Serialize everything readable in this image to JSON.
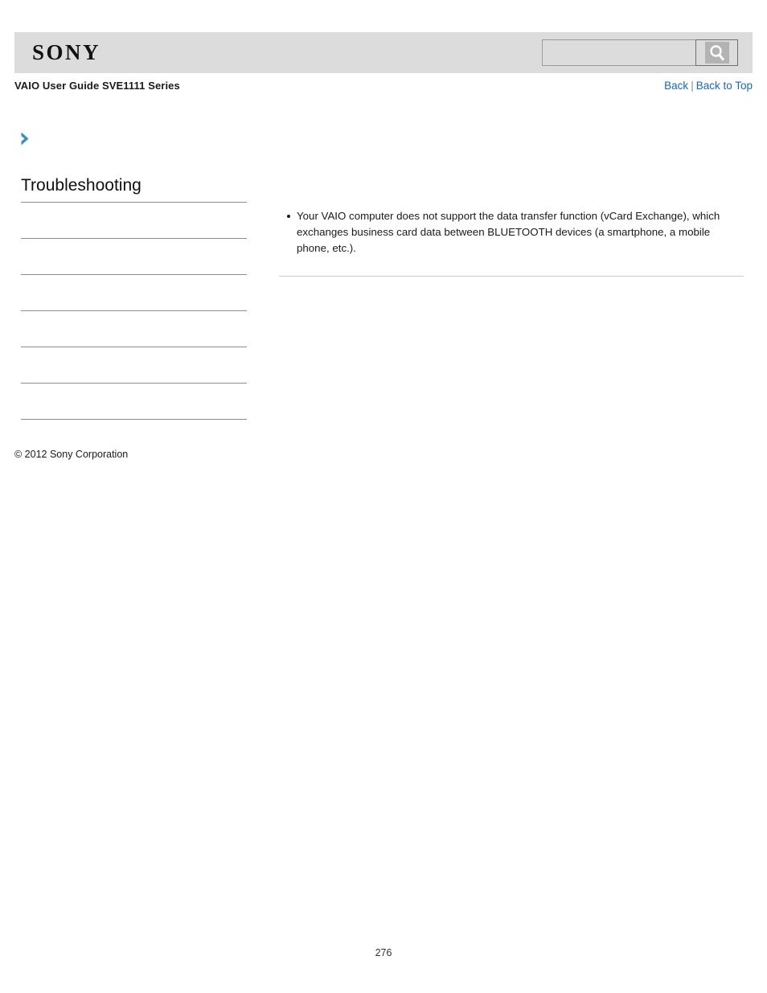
{
  "header": {
    "logo_text": "SONY",
    "logo_icon": "sony-wordmark",
    "background_color": "#dcdcdc"
  },
  "search": {
    "value": "",
    "placeholder": "",
    "button_icon": "search-icon",
    "button_label": "Search"
  },
  "subheader": {
    "guide_title": "VAIO User Guide SVE1111 Series",
    "links": [
      {
        "label": "Back"
      },
      {
        "label": "Back to Top"
      }
    ],
    "separator": "|",
    "link_color": "#1668c4"
  },
  "breadcrumb_icon": {
    "name": "chevron-right-icon",
    "color": "#3a8dc8"
  },
  "sidebar": {
    "title": "Troubleshooting",
    "items": [
      {
        "label": ""
      },
      {
        "label": ""
      },
      {
        "label": ""
      },
      {
        "label": ""
      },
      {
        "label": ""
      },
      {
        "label": ""
      }
    ]
  },
  "main": {
    "bullets": [
      "Your VAIO computer does not support the data transfer function (vCard Exchange), which exchanges business card data between BLUETOOTH devices (a smartphone, a mobile phone, etc.)."
    ]
  },
  "footer": {
    "copyright": "© 2012 Sony Corporation",
    "page_number": "276"
  }
}
